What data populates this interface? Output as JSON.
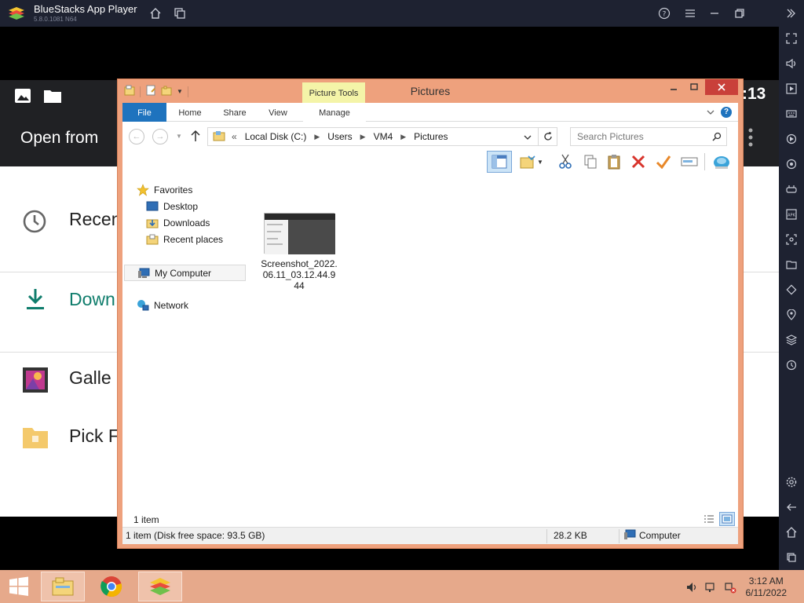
{
  "app": {
    "title": "BlueStacks App Player",
    "version": "5.8.0.1081 N64"
  },
  "android": {
    "time": ":13",
    "header_title": "Open from",
    "items": [
      {
        "label": "Recen",
        "icon": "clock-icon"
      },
      {
        "label": "Down",
        "icon": "download-icon"
      },
      {
        "label": "Galle",
        "icon": "gallery-icon"
      },
      {
        "label": "Pick F",
        "icon": "folder-icon"
      }
    ]
  },
  "explorer": {
    "window_title": "Pictures",
    "picture_tools_label": "Picture Tools",
    "tabs": [
      {
        "label": "File"
      },
      {
        "label": "Home"
      },
      {
        "label": "Share"
      },
      {
        "label": "View"
      },
      {
        "label": "Manage"
      }
    ],
    "address": {
      "prefix": "«",
      "segments": [
        "Local Disk (C:)",
        "Users",
        "VM4",
        "Pictures"
      ]
    },
    "search_placeholder": "Search Pictures",
    "nav": {
      "favorites": "Favorites",
      "desktop": "Desktop",
      "downloads": "Downloads",
      "recent_places": "Recent places",
      "my_computer": "My Computer",
      "network": "Network"
    },
    "files": [
      {
        "name": "Screenshot_2022.06.11_03.12.44.944"
      }
    ],
    "status_items": "1 item",
    "status_bar": {
      "disk_info": "1 item (Disk free space: 93.5 GB)",
      "size": "28.2 KB",
      "location": "Computer"
    }
  },
  "taskbar": {
    "time": "3:12 AM",
    "date": "6/11/2022"
  },
  "colors": {
    "explorer_frame": "#eea17d",
    "file_tab": "#1e73be",
    "taskbar": "#e6a98b",
    "bluestacks_chrome": "#1e2231",
    "download_green": "#0f7d6c"
  }
}
